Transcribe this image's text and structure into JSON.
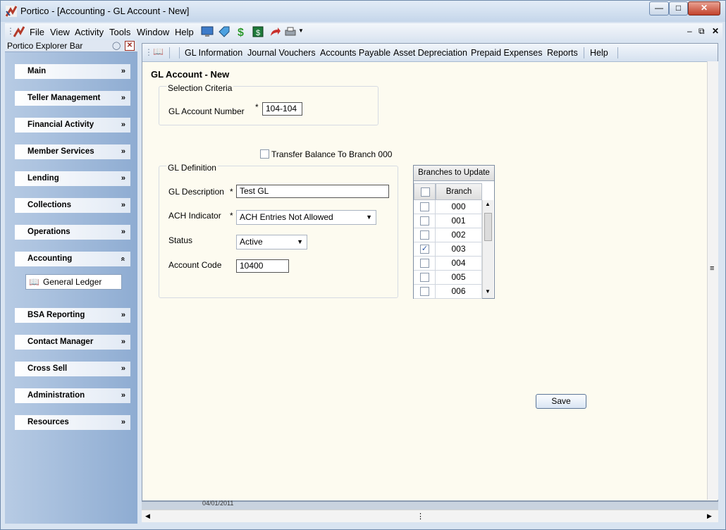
{
  "window": {
    "title": "Portico - [Accounting - GL Account - New]"
  },
  "menu": [
    "File",
    "View",
    "Activity",
    "Tools",
    "Window",
    "Help"
  ],
  "explorer": {
    "title": "Portico Explorer Bar",
    "groups": [
      "Main",
      "Teller Management",
      "Financial Activity",
      "Member Services",
      "Lending",
      "Collections",
      "Operations",
      "Accounting",
      "BSA Reporting",
      "Contact Manager",
      "Cross Sell",
      "Administration",
      "Resources"
    ],
    "accounting_sub": "General Ledger"
  },
  "nav": [
    "GL Information",
    "Journal Vouchers",
    "Accounts Payable",
    "Asset Depreciation",
    "Prepaid Expenses",
    "Reports",
    "Help"
  ],
  "page": {
    "title": "GL Account - New"
  },
  "selection": {
    "legend": "Selection Criteria",
    "gl_label": "GL Account Number",
    "req": "*",
    "gl_value": "104-104"
  },
  "transfer": {
    "label": "Transfer Balance To Branch 000",
    "checked": false
  },
  "definition": {
    "legend": "GL Definition",
    "desc_label": "GL Description",
    "desc_value": "Test GL",
    "ach_label": "ACH Indicator",
    "ach_value": "ACH Entries Not Allowed",
    "status_label": "Status",
    "status_value": "Active",
    "code_label": "Account Code",
    "code_value": "10400"
  },
  "branches": {
    "header": "Branches to Update",
    "col": "Branch",
    "rows": [
      {
        "branch": "000",
        "checked": false
      },
      {
        "branch": "001",
        "checked": false
      },
      {
        "branch": "002",
        "checked": false
      },
      {
        "branch": "003",
        "checked": true
      },
      {
        "branch": "004",
        "checked": false
      },
      {
        "branch": "005",
        "checked": false
      },
      {
        "branch": "006",
        "checked": false
      }
    ]
  },
  "buttons": {
    "save": "Save"
  },
  "statusbar": {
    "date": "04/01/2011"
  }
}
